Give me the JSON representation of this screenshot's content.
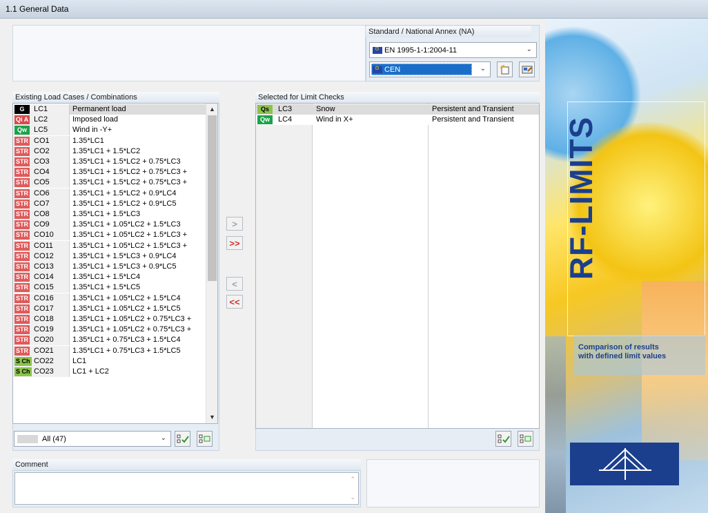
{
  "window": {
    "title": "1.1 General Data"
  },
  "standard": {
    "header": "Standard / National Annex (NA)",
    "norm_value": "EN 1995-1-1:2004-11",
    "annex_value": "CEN"
  },
  "existing": {
    "header": "Existing Load Cases / Combinations",
    "items": [
      {
        "tag": "G",
        "tag_color": "#000000",
        "id": "LC1",
        "desc": "Permanent load"
      },
      {
        "tag": "Qi A",
        "tag_color": "#d84b4b",
        "id": "LC2",
        "desc": "Imposed load"
      },
      {
        "tag": "Qw",
        "tag_color": "#1aa34a",
        "id": "LC5",
        "desc": "Wind in -Y+"
      },
      {
        "tag": "STR",
        "tag_color": "#e05a5a",
        "id": "CO1",
        "desc": "1.35*LC1"
      },
      {
        "tag": "STR",
        "tag_color": "#e05a5a",
        "id": "CO2",
        "desc": "1.35*LC1 + 1.5*LC2"
      },
      {
        "tag": "STR",
        "tag_color": "#e05a5a",
        "id": "CO3",
        "desc": "1.35*LC1 + 1.5*LC2 + 0.75*LC3"
      },
      {
        "tag": "STR",
        "tag_color": "#e05a5a",
        "id": "CO4",
        "desc": "1.35*LC1 + 1.5*LC2 + 0.75*LC3 +"
      },
      {
        "tag": "STR",
        "tag_color": "#e05a5a",
        "id": "CO5",
        "desc": "1.35*LC1 + 1.5*LC2 + 0.75*LC3 +"
      },
      {
        "tag": "STR",
        "tag_color": "#e05a5a",
        "id": "CO6",
        "desc": "1.35*LC1 + 1.5*LC2 + 0.9*LC4"
      },
      {
        "tag": "STR",
        "tag_color": "#e05a5a",
        "id": "CO7",
        "desc": "1.35*LC1 + 1.5*LC2 + 0.9*LC5"
      },
      {
        "tag": "STR",
        "tag_color": "#e05a5a",
        "id": "CO8",
        "desc": "1.35*LC1 + 1.5*LC3"
      },
      {
        "tag": "STR",
        "tag_color": "#e05a5a",
        "id": "CO9",
        "desc": "1.35*LC1 + 1.05*LC2 + 1.5*LC3"
      },
      {
        "tag": "STR",
        "tag_color": "#e05a5a",
        "id": "CO10",
        "desc": "1.35*LC1 + 1.05*LC2 + 1.5*LC3 +"
      },
      {
        "tag": "STR",
        "tag_color": "#e05a5a",
        "id": "CO11",
        "desc": "1.35*LC1 + 1.05*LC2 + 1.5*LC3 +"
      },
      {
        "tag": "STR",
        "tag_color": "#e05a5a",
        "id": "CO12",
        "desc": "1.35*LC1 + 1.5*LC3 + 0.9*LC4"
      },
      {
        "tag": "STR",
        "tag_color": "#e05a5a",
        "id": "CO13",
        "desc": "1.35*LC1 + 1.5*LC3 + 0.9*LC5"
      },
      {
        "tag": "STR",
        "tag_color": "#e05a5a",
        "id": "CO14",
        "desc": "1.35*LC1 + 1.5*LC4"
      },
      {
        "tag": "STR",
        "tag_color": "#e05a5a",
        "id": "CO15",
        "desc": "1.35*LC1 + 1.5*LC5"
      },
      {
        "tag": "STR",
        "tag_color": "#e05a5a",
        "id": "CO16",
        "desc": "1.35*LC1 + 1.05*LC2 + 1.5*LC4"
      },
      {
        "tag": "STR",
        "tag_color": "#e05a5a",
        "id": "CO17",
        "desc": "1.35*LC1 + 1.05*LC2 + 1.5*LC5"
      },
      {
        "tag": "STR",
        "tag_color": "#e05a5a",
        "id": "CO18",
        "desc": "1.35*LC1 + 1.05*LC2 + 0.75*LC3 +"
      },
      {
        "tag": "STR",
        "tag_color": "#e05a5a",
        "id": "CO19",
        "desc": "1.35*LC1 + 1.05*LC2 + 0.75*LC3 +"
      },
      {
        "tag": "STR",
        "tag_color": "#e05a5a",
        "id": "CO20",
        "desc": "1.35*LC1 + 0.75*LC3 + 1.5*LC4"
      },
      {
        "tag": "STR",
        "tag_color": "#e05a5a",
        "id": "CO21",
        "desc": "1.35*LC1 + 0.75*LC3 + 1.5*LC5"
      },
      {
        "tag": "S Ch",
        "tag_color": "#8bc34a",
        "id": "CO22",
        "desc": "LC1"
      },
      {
        "tag": "S Ch",
        "tag_color": "#8bc34a",
        "id": "CO23",
        "desc": "LC1 + LC2"
      }
    ],
    "filter_value": "All (47)"
  },
  "transfer": {
    "add_one": ">",
    "add_all": ">>",
    "remove_one": "<",
    "remove_all": "<<"
  },
  "selected": {
    "header": "Selected for Limit Checks",
    "items": [
      {
        "tag": "Qs",
        "tag_color": "#8bc34a",
        "id": "LC3",
        "desc": "Snow",
        "situation": "Persistent and Transient"
      },
      {
        "tag": "Qw",
        "tag_color": "#1aa34a",
        "id": "LC4",
        "desc": "Wind in X+",
        "situation": "Persistent and Transient"
      }
    ]
  },
  "comment": {
    "header": "Comment",
    "value": ""
  },
  "sidebar": {
    "product": "RF-LIMITS",
    "description_line1": "Comparison of results",
    "description_line2": "with defined limit values"
  }
}
